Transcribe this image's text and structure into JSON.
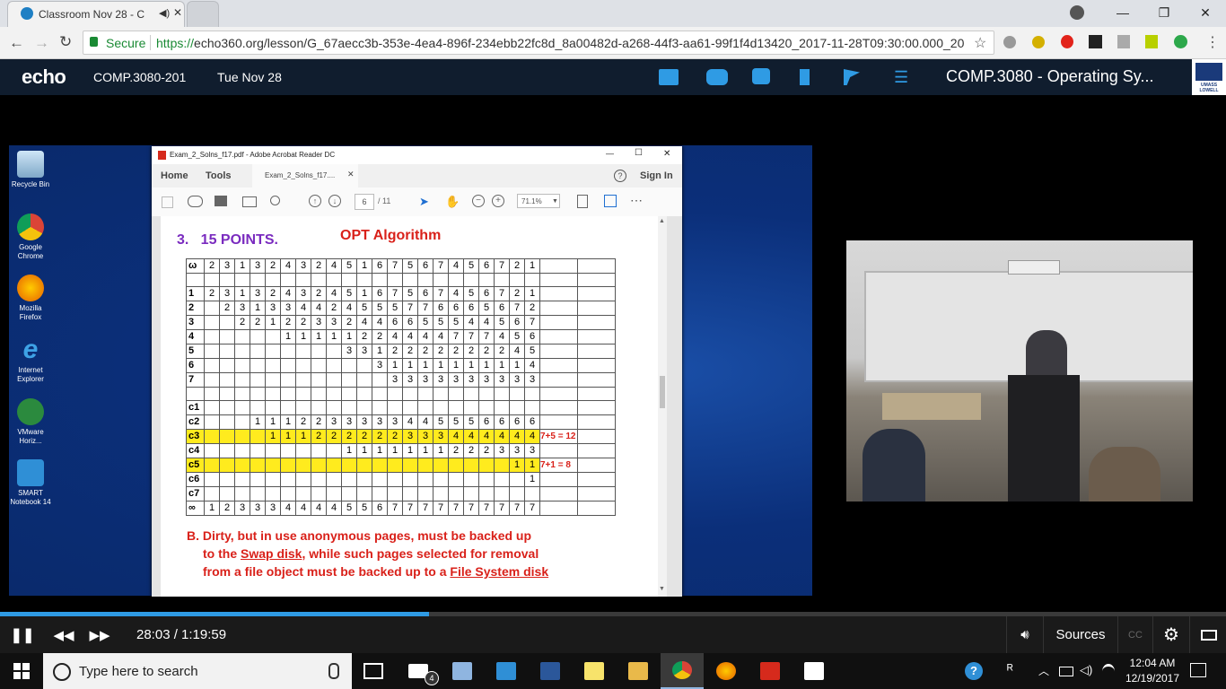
{
  "browser": {
    "tab_title": "Classroom Nov 28 - C",
    "secure_label": "Secure",
    "url_scheme": "https://",
    "url_rest": "echo360.org/lesson/G_67aecc3b-353e-4ea4-896f-234ebb22fc8d_8a00482d-a268-44f3-aa61-99f1f4d13420_2017-11-28T09:30:00.000_20..."
  },
  "echo_header": {
    "logo": "echo",
    "course_code": "COMP.3080-201",
    "date": "Tue Nov 28",
    "course_title": "COMP.3080 - Operating Sy...",
    "school_logo_text": "UMASS LOWELL"
  },
  "desktop_icons": [
    {
      "label": "Recycle Bin"
    },
    {
      "label": "Google Chrome"
    },
    {
      "label": "Mozilla Firefox"
    },
    {
      "label": "Internet Explorer"
    },
    {
      "label": "VMware Horiz..."
    },
    {
      "label": "SMART Notebook 14"
    }
  ],
  "acrobat": {
    "window_title": "Exam_2_Solns_f17.pdf - Adobe Acrobat Reader DC",
    "home": "Home",
    "tools": "Tools",
    "doc_tab": "Exam_2_Solns_f17....",
    "sign_in": "Sign In",
    "page_current": "6",
    "page_total": "/ 11",
    "zoom": "71.1%"
  },
  "document": {
    "question": "3.   15 POINTS.",
    "heading": "OPT Algorithm",
    "ref_label": "ω",
    "ref_string": [
      "2",
      "3",
      "1",
      "3",
      "2",
      "4",
      "3",
      "2",
      "4",
      "5",
      "1",
      "6",
      "7",
      "5",
      "6",
      "7",
      "4",
      "5",
      "6",
      "7",
      "2",
      "1"
    ],
    "rows": [
      {
        "label": "1",
        "cells": [
          "1",
          "2",
          "3",
          "1",
          "3",
          "2",
          "4",
          "3",
          "2",
          "4",
          "5",
          "1",
          "6",
          "7",
          "5",
          "6",
          "7",
          "4",
          "5",
          "6",
          "7",
          "2",
          "1"
        ],
        "note": "",
        "hl": false
      },
      {
        "label": "2",
        "cells": [
          "",
          "2",
          "3",
          "1",
          "3",
          "3",
          "4",
          "4",
          "2",
          "4",
          "5",
          "5",
          "5",
          "7",
          "7",
          "6",
          "6",
          "6",
          "5",
          "6",
          "7",
          "2"
        ],
        "note": "",
        "hl": false
      },
      {
        "label": "3",
        "cells": [
          "",
          "",
          "2",
          "2",
          "1",
          "2",
          "2",
          "3",
          "3",
          "2",
          "4",
          "4",
          "6",
          "6",
          "5",
          "5",
          "5",
          "4",
          "4",
          "5",
          "6",
          "7"
        ],
        "note": "",
        "hl": false
      },
      {
        "label": "4",
        "cells": [
          "",
          "",
          "",
          "",
          "",
          "1",
          "1",
          "1",
          "1",
          "1",
          "2",
          "2",
          "4",
          "4",
          "4",
          "4",
          "7",
          "7",
          "7",
          "4",
          "5",
          "6"
        ],
        "note": "",
        "hl": false
      },
      {
        "label": "5",
        "cells": [
          "",
          "",
          "",
          "",
          "",
          "",
          "",
          "",
          "",
          "3",
          "3",
          "1",
          "2",
          "2",
          "2",
          "2",
          "2",
          "2",
          "2",
          "2",
          "4",
          "5"
        ],
        "note": "",
        "hl": false
      },
      {
        "label": "6",
        "cells": [
          "",
          "",
          "",
          "",
          "",
          "",
          "",
          "",
          "",
          "",
          "",
          "3",
          "1",
          "1",
          "1",
          "1",
          "1",
          "1",
          "1",
          "1",
          "1",
          "4"
        ],
        "note": "",
        "hl": false
      },
      {
        "label": "7",
        "cells": [
          "",
          "",
          "",
          "",
          "",
          "",
          "",
          "",
          "",
          "",
          "",
          "",
          "3",
          "3",
          "3",
          "3",
          "3",
          "3",
          "3",
          "3",
          "3",
          "3"
        ],
        "note": "",
        "hl": false
      },
      {
        "label": "",
        "cells": [
          "",
          "",
          "",
          "",
          "",
          "",
          "",
          "",
          "",
          "",
          "",
          "",
          "",
          "",
          "",
          "",
          "",
          "",
          "",
          "",
          "",
          ""
        ],
        "note": "",
        "hl": false
      },
      {
        "label": "c1",
        "cells": [
          "",
          "",
          "",
          "",
          "",
          "",
          "",
          "",
          "",
          "",
          "",
          "",
          "",
          "",
          "",
          "",
          "",
          "",
          "",
          "",
          "",
          ""
        ],
        "note": "",
        "hl": false
      },
      {
        "label": "c2",
        "cells": [
          "",
          "",
          "",
          "1",
          "1",
          "1",
          "2",
          "2",
          "3",
          "3",
          "3",
          "3",
          "3",
          "4",
          "4",
          "5",
          "5",
          "5",
          "6",
          "6",
          "6",
          "6"
        ],
        "note": "",
        "hl": false
      },
      {
        "label": "c3",
        "cells": [
          "",
          "",
          "",
          "",
          "1",
          "1",
          "1",
          "2",
          "2",
          "2",
          "2",
          "2",
          "2",
          "3",
          "3",
          "3",
          "4",
          "4",
          "4",
          "4",
          "4",
          "4"
        ],
        "note": "7+5 = 12",
        "hl": true
      },
      {
        "label": "c4",
        "cells": [
          "",
          "",
          "",
          "",
          "",
          "",
          "",
          "",
          "",
          "1",
          "1",
          "1",
          "1",
          "1",
          "1",
          "1",
          "2",
          "2",
          "2",
          "3",
          "3",
          "3"
        ],
        "note": "",
        "hl": false
      },
      {
        "label": "c5",
        "cells": [
          "",
          "",
          "",
          "",
          "",
          "",
          "",
          "",
          "",
          "",
          "",
          "",
          "",
          "",
          "",
          "",
          "",
          "",
          "",
          "",
          "1",
          "1"
        ],
        "note": "7+1 = 8",
        "hl": true
      },
      {
        "label": "c6",
        "cells": [
          "",
          "",
          "",
          "",
          "",
          "",
          "",
          "",
          "",
          "",
          "",
          "",
          "",
          "",
          "",
          "",
          "",
          "",
          "",
          "",
          "",
          "1"
        ],
        "note": "",
        "hl": false
      },
      {
        "label": "c7",
        "cells": [
          "",
          "",
          "",
          "",
          "",
          "",
          "",
          "",
          "",
          "",
          "",
          "",
          "",
          "",
          "",
          "",
          "",
          "",
          "",
          "",
          "",
          ""
        ],
        "note": "",
        "hl": false
      },
      {
        "label": "∞",
        "cells": [
          "1",
          "2",
          "3",
          "3",
          "3",
          "4",
          "4",
          "4",
          "4",
          "5",
          "5",
          "6",
          "7",
          "7",
          "7",
          "7",
          "7",
          "7",
          "7",
          "7",
          "7",
          "7"
        ],
        "note": "",
        "hl": false
      }
    ],
    "answer_b_line1": "B. Dirty, but in use anonymous pages, must be backed up",
    "answer_b_line2_pre": "to the ",
    "answer_b_swap": "Swap disk",
    "answer_b_line2_post": ", while such pages selected for removal",
    "answer_b_line3_pre": "from a file object must be backed up to a ",
    "answer_b_fs": "File System disk"
  },
  "player": {
    "time": "28:03 / 1:19:59",
    "progress_fraction": 0.35,
    "sources": "Sources",
    "cc": "CC"
  },
  "taskbar": {
    "search_placeholder": "Type here to search",
    "time": "12:04 AM",
    "date": "12/19/2017",
    "mail_badge": "4"
  },
  "colors": {
    "echo_header": "#101d2e",
    "accent_blue": "#2f9be4",
    "answer_red": "#d9211a",
    "highlight_yellow": "#ffeb1e",
    "question_purple": "#7a2bbf"
  }
}
